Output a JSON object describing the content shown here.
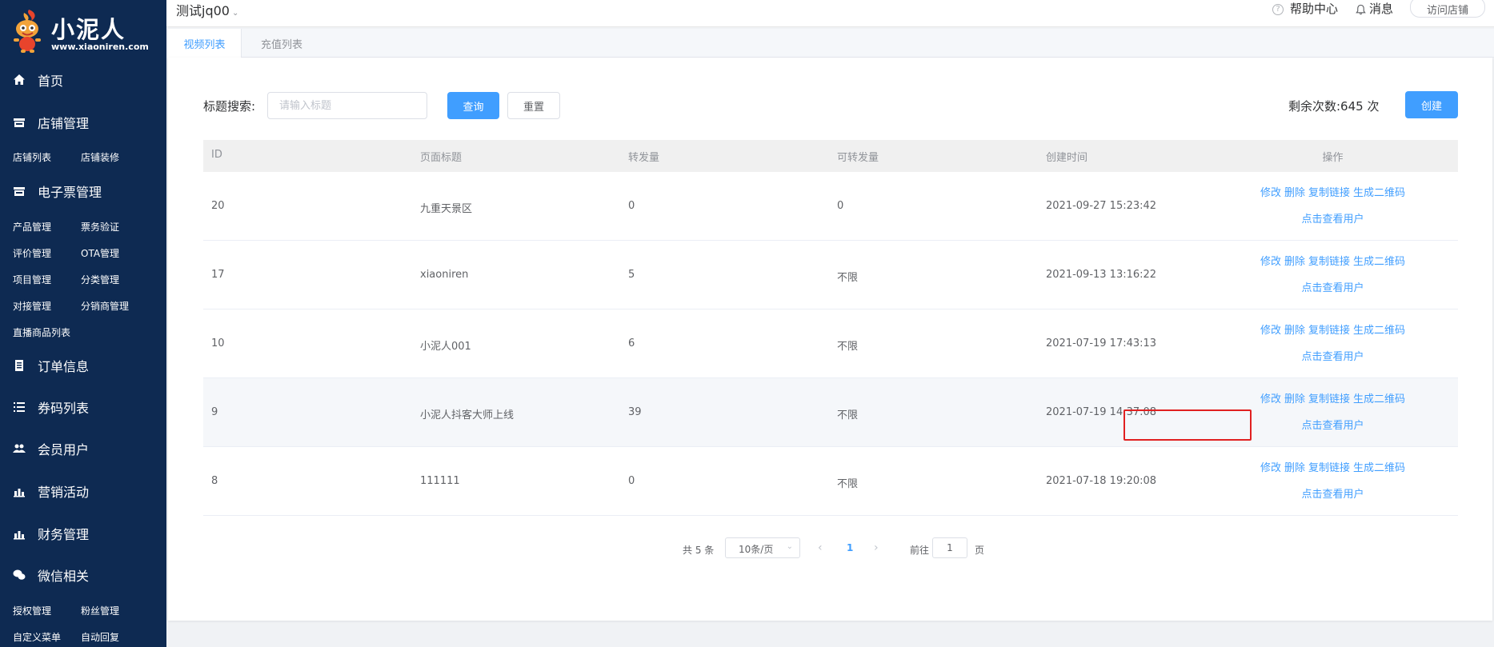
{
  "brand": {
    "name": "小泥人",
    "url": "www.xiaoniren.com"
  },
  "sidebar": {
    "home": "首页",
    "store": {
      "label": "店铺管理",
      "subs": [
        "店铺列表",
        "店铺装修"
      ]
    },
    "eticket": {
      "label": "电子票管理",
      "subs": [
        "产品管理",
        "票务验证",
        "评价管理",
        "OTA管理",
        "项目管理",
        "分类管理",
        "对接管理",
        "分销商管理",
        "直播商品列表"
      ]
    },
    "orders": "订单信息",
    "coupons": "券码列表",
    "members": "会员用户",
    "marketing": "营销活动",
    "finance": "财务管理",
    "wechat": {
      "label": "微信相关",
      "subs": [
        "授权管理",
        "粉丝管理",
        "自定义菜单",
        "自动回复"
      ]
    }
  },
  "header": {
    "shop_name": "测试jq00",
    "help": "帮助中心",
    "messages": "消息",
    "visit_store": "访问店铺"
  },
  "tabs": [
    "视频列表",
    "充值列表"
  ],
  "toolbar": {
    "search_label": "标题搜索:",
    "search_placeholder": "请输入标题",
    "query": "查询",
    "reset": "重置",
    "remain": "剩余次数:645 次",
    "create": "创建"
  },
  "table": {
    "headers": [
      "ID",
      "页面标题",
      "转发量",
      "可转发量",
      "创建时间",
      "操作"
    ],
    "actions": [
      "修改",
      "删除",
      "复制链接",
      "生成二维码"
    ],
    "view_users": "点击查看用户",
    "rows": [
      {
        "id": "20",
        "title": "九重天景区",
        "forward": "0",
        "can_forward": "0",
        "created": "2021-09-27 15:23:42"
      },
      {
        "id": "17",
        "title": "xiaoniren",
        "forward": "5",
        "can_forward": "不限",
        "created": "2021-09-13 13:16:22"
      },
      {
        "id": "10",
        "title": "小泥人001",
        "forward": "6",
        "can_forward": "不限",
        "created": "2021-07-19 17:43:13"
      },
      {
        "id": "9",
        "title": "小泥人抖客大师上线",
        "forward": "39",
        "can_forward": "不限",
        "created": "2021-07-19 14:37:08"
      },
      {
        "id": "8",
        "title": "111111",
        "forward": "0",
        "can_forward": "不限",
        "created": "2021-07-18 19:20:08"
      }
    ]
  },
  "pagination": {
    "total": "共 5 条",
    "page_size": "10条/页",
    "current": "1",
    "goto": "前往",
    "goto_value": "1",
    "page_suffix": "页"
  },
  "colors": {
    "sidebar_bg": "#0e2a52",
    "primary": "#409eff",
    "highlight": "#e02020"
  }
}
